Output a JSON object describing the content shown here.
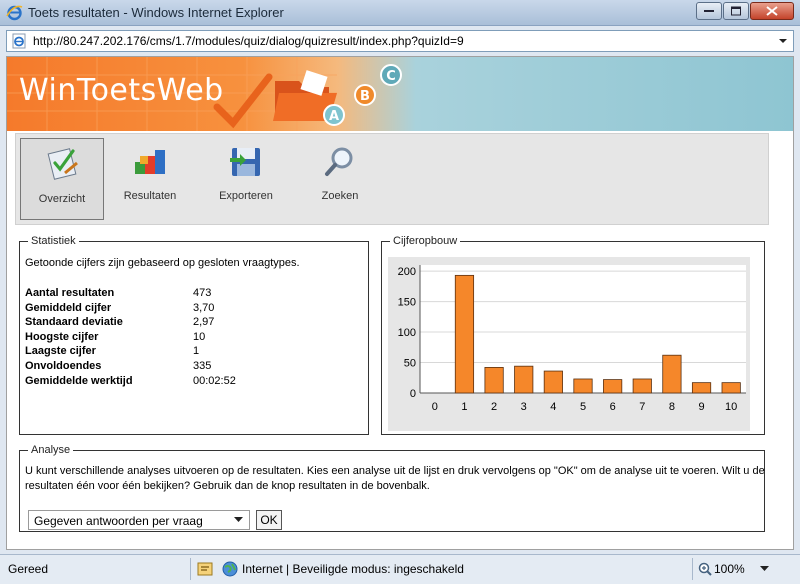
{
  "window": {
    "title": "Toets resultaten - Windows Internet Explorer",
    "url": "http://80.247.202.176/cms/1.7/modules/quiz/dialog/quizresult/index.php?quizId=9"
  },
  "banner": {
    "logo": "WinToetsWeb",
    "badges": [
      "A",
      "B",
      "C"
    ]
  },
  "toolbar": {
    "items": [
      {
        "label": "Overzicht",
        "icon": "checklist-icon",
        "active": true
      },
      {
        "label": "Resultaten",
        "icon": "blocks-icon",
        "active": false
      },
      {
        "label": "Exporteren",
        "icon": "floppy-disk-icon",
        "active": false
      },
      {
        "label": "Zoeken",
        "icon": "magnifier-icon",
        "active": false
      }
    ]
  },
  "statistiek": {
    "legend": "Statistiek",
    "note": "Getoonde cijfers zijn gebaseerd op gesloten vraagtypes.",
    "rows": [
      {
        "key": "Aantal resultaten",
        "value": "473"
      },
      {
        "key": "Gemiddeld cijfer",
        "value": "3,70"
      },
      {
        "key": "Standaard deviatie",
        "value": "2,97"
      },
      {
        "key": "Hoogste cijfer",
        "value": "10"
      },
      {
        "key": "Laagste cijfer",
        "value": "1"
      },
      {
        "key": "Onvoldoendes",
        "value": "335"
      },
      {
        "key": "Gemiddelde werktijd",
        "value": "00:02:52"
      }
    ]
  },
  "cijferopbouw": {
    "legend": "Cijferopbouw"
  },
  "chart_data": {
    "type": "bar",
    "categories": [
      "0",
      "1",
      "2",
      "3",
      "4",
      "5",
      "6",
      "7",
      "8",
      "9",
      "10"
    ],
    "values": [
      0,
      193,
      42,
      44,
      36,
      23,
      22,
      23,
      62,
      17,
      17
    ],
    "yticks": [
      0,
      50,
      100,
      150,
      200
    ],
    "ylim": [
      0,
      210
    ],
    "grid": true,
    "bar_color": "#f5872a"
  },
  "analyse": {
    "legend": "Analyse",
    "text": "U kunt verschillende analyses uitvoeren op de resultaten. Kies een analyse uit de lijst en druk vervolgens op \"OK\" om de analyse uit te voeren. Wilt u de resultaten één voor één bekijken? Gebruik dan de knop resultaten in de bovenbalk.",
    "select_value": "Gegeven antwoorden per vraag",
    "ok_label": "OK"
  },
  "statusbar": {
    "state": "Gereed",
    "zone": "Internet | Beveiligde modus: ingeschakeld",
    "zoom": "100%"
  },
  "colors": {
    "accent": "#f5872a",
    "banner_blue": "#8ec5d2"
  }
}
